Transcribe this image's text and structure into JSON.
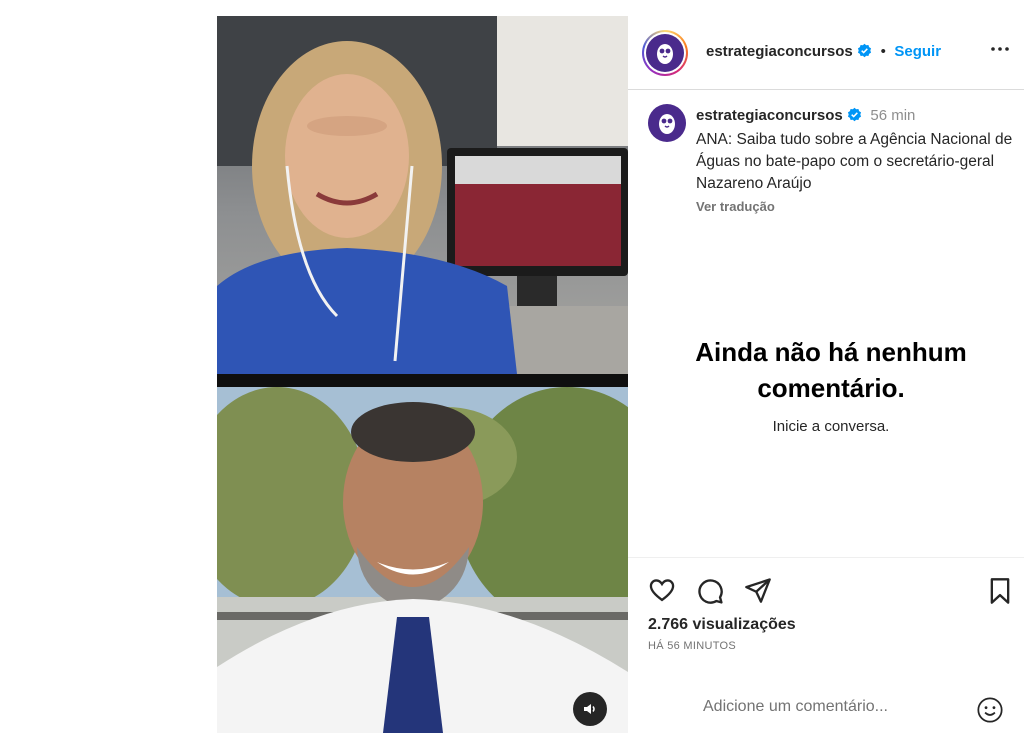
{
  "post": {
    "username": "estrategiaconcursos",
    "follow_label": "Seguir",
    "separator": "•"
  },
  "caption": {
    "username": "estrategiaconcursos",
    "time": "56 min",
    "text": "ANA: Saiba tudo sobre a Agência Nacional de Águas no bate-papo com o secretário-geral Nazareno Araújo",
    "translate_label": "Ver tradução"
  },
  "comments": {
    "empty_title": "Ainda não há nenhum comentário.",
    "empty_subtitle": "Inicie a conversa."
  },
  "stats": {
    "views": "2.766 visualizações",
    "time_ago": "HÁ 56 MINUTOS"
  },
  "comment_box": {
    "placeholder": "Adicione um comentário..."
  },
  "icons": {
    "like": "heart-icon",
    "comment": "comment-icon",
    "share": "share-icon",
    "save": "bookmark-icon",
    "more": "more-icon",
    "emoji": "emoji-icon",
    "mute": "volume-icon",
    "verified": "verified-badge-icon"
  },
  "colors": {
    "accent": "#0095f6",
    "avatar_bg": "#4a2a8c",
    "verified": "#0095f6"
  }
}
